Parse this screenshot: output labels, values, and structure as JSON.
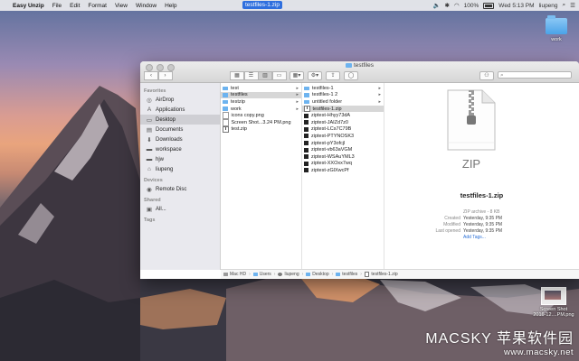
{
  "menubar": {
    "app_name": "Easy Unzip",
    "items": [
      "File",
      "Edit",
      "Format",
      "View",
      "Window",
      "Help"
    ],
    "center_title": "testfiles-1.zip",
    "battery": "100%",
    "datetime": "Wed 5:13 PM",
    "user": "liupeng"
  },
  "desktop": {
    "folder_label": "work",
    "screenshot_label_1": "Screen Shot",
    "screenshot_label_2": "2016-12....PM.png"
  },
  "window": {
    "title": "testfiles",
    "sidebar": {
      "favorites_header": "Favorites",
      "favorites": [
        {
          "label": "AirDrop",
          "icon": "airdrop-icon"
        },
        {
          "label": "Applications",
          "icon": "applications-icon"
        },
        {
          "label": "Desktop",
          "icon": "desktop-icon"
        },
        {
          "label": "Documents",
          "icon": "documents-icon"
        },
        {
          "label": "Downloads",
          "icon": "downloads-icon"
        },
        {
          "label": "workspace",
          "icon": "folder-icon"
        },
        {
          "label": "hjw",
          "icon": "folder-icon"
        },
        {
          "label": "liupeng",
          "icon": "home-icon"
        }
      ],
      "devices_header": "Devices",
      "devices": [
        {
          "label": "Remote Disc",
          "icon": "disc-icon"
        }
      ],
      "shared_header": "Shared",
      "shared": [
        {
          "label": "All...",
          "icon": "network-icon"
        }
      ],
      "tags_header": "Tags"
    },
    "column1": [
      {
        "label": "test",
        "type": "folder"
      },
      {
        "label": "testfiles",
        "type": "folder"
      },
      {
        "label": "testzip",
        "type": "folder"
      },
      {
        "label": "work",
        "type": "folder"
      },
      {
        "label": "icons copy.png",
        "type": "file"
      },
      {
        "label": "Screen Shot...3.24 PM.png",
        "type": "file"
      },
      {
        "label": "test.zip",
        "type": "file"
      }
    ],
    "column2": [
      {
        "label": "testfiles-1",
        "type": "folder"
      },
      {
        "label": "testfiles-1 2",
        "type": "folder"
      },
      {
        "label": "untitled folder",
        "type": "folder"
      },
      {
        "label": "testfiles-1.zip",
        "type": "zip"
      },
      {
        "label": "ziptest-Hhyy73dA",
        "type": "black"
      },
      {
        "label": "ziptest-JAIZd7z0",
        "type": "black"
      },
      {
        "label": "ziptest-LCs7C79B",
        "type": "black"
      },
      {
        "label": "ziptest-PTYNOSK3",
        "type": "black"
      },
      {
        "label": "ziptest-pY3ofcjl",
        "type": "black"
      },
      {
        "label": "ziptest-vb63aVGM",
        "type": "black"
      },
      {
        "label": "ziptest-WSAuYML3",
        "type": "black"
      },
      {
        "label": "ziptest-XXOxx7wq",
        "type": "black"
      },
      {
        "label": "ziptest-zGlXwcPf",
        "type": "black"
      }
    ],
    "preview": {
      "icon_text": "ZIP",
      "name": "testfiles-1.zip",
      "kind": "ZIP archive - 8 KB",
      "created_label": "Created",
      "created": "Yesterday, 9:35 PM",
      "modified_label": "Modified",
      "modified": "Yesterday, 9:35 PM",
      "last_opened_label": "Last opened",
      "last_opened": "Yesterday, 9:35 PM",
      "add_tags": "Add Tags..."
    },
    "pathbar": [
      "Mac HD",
      "Users",
      "liupeng",
      "Desktop",
      "testfiles",
      "testfiles-1.zip"
    ]
  },
  "watermark": {
    "main": "MACSKY 苹果软件园",
    "url": "www.macsky.net"
  }
}
